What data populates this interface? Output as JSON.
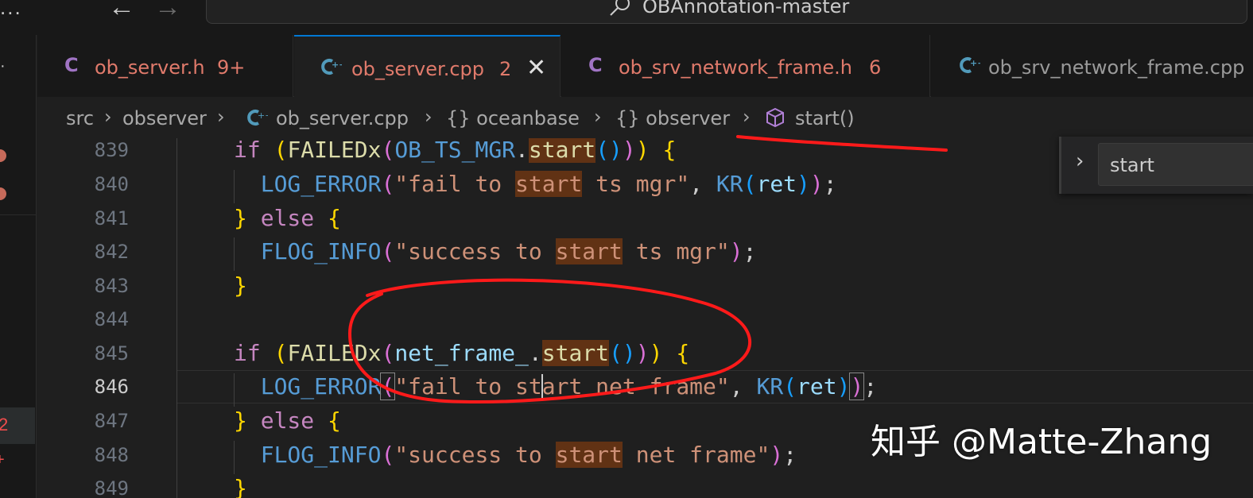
{
  "window": {
    "title": "OBAnnotation-master",
    "overflow_menu": "..."
  },
  "activity_bar": {
    "problems_count": "2",
    "plus_badge": "+"
  },
  "tabs": [
    {
      "icon": "C",
      "label": "ob_server.h",
      "count": "9+",
      "active": false
    },
    {
      "icon": "G",
      "label": "ob_server.cpp",
      "count": "2",
      "active": true
    },
    {
      "icon": "C",
      "label": "ob_srv_network_frame.h",
      "count": "6",
      "active": false
    },
    {
      "icon": "G",
      "label": "ob_srv_network_frame.cpp",
      "count": "",
      "active": false
    }
  ],
  "breadcrumb": {
    "items": [
      "src",
      "observer",
      "ob_server.cpp",
      "{} oceanbase",
      "{} observer",
      "start()"
    ]
  },
  "find": {
    "value": "start"
  },
  "editor": {
    "line_numbers": [
      "839",
      "840",
      "841",
      "842",
      "843",
      "844",
      "845",
      "846",
      "847",
      "848",
      "849"
    ],
    "current_line": "846",
    "tokens": {
      "if": "if",
      "else": "else",
      "failedx": "FAILEDx",
      "ob_ts_mgr": "OB_TS_MGR",
      "net_frame": "net_frame_",
      "start": "start",
      "log_error": "LOG_ERROR",
      "flog_info": "FLOG_INFO",
      "kr": "KR",
      "ret": "ret",
      "str_840_a": "\"fail to ",
      "str_840_b": " ts mgr\"",
      "str_842_a": "\"success to ",
      "str_842_b": " ts mgr\"",
      "str_846_a": "\"fail to st",
      "str_846_b": "art",
      "str_846_c": " net frame\"",
      "str_848_a": "\"success to ",
      "str_848_b": " net frame\""
    }
  },
  "watermark": "知乎 @Matte-Zhang",
  "colors": {
    "accent": "#0078d4",
    "annotation": "#ff1a1a",
    "find_match": "#613214"
  }
}
